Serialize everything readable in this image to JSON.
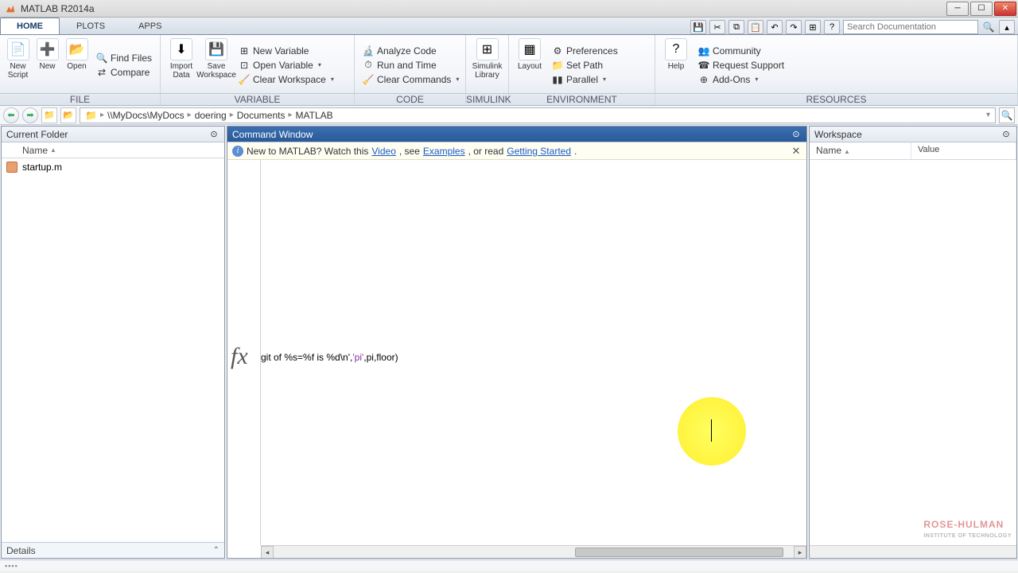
{
  "title": "MATLAB R2014a",
  "tabs": {
    "home": "HOME",
    "plots": "PLOTS",
    "apps": "APPS"
  },
  "search_placeholder": "Search Documentation",
  "ribbon": {
    "new_script": "New\nScript",
    "new": "New",
    "open": "Open",
    "find_files": "Find Files",
    "compare": "Compare",
    "import": "Import\nData",
    "save_ws": "Save\nWorkspace",
    "new_var": "New Variable",
    "open_var": "Open Variable",
    "clear_ws": "Clear Workspace",
    "analyze": "Analyze Code",
    "run_time": "Run and Time",
    "clear_cmd": "Clear Commands",
    "simulink": "Simulink\nLibrary",
    "layout": "Layout",
    "prefs": "Preferences",
    "setpath": "Set Path",
    "parallel": "Parallel",
    "help": "Help",
    "community": "Community",
    "support": "Request Support",
    "addons": "Add-Ons"
  },
  "groups": {
    "file": "FILE",
    "variable": "VARIABLE",
    "code": "CODE",
    "simulink": "SIMULINK",
    "environment": "ENVIRONMENT",
    "resources": "RESOURCES"
  },
  "path": {
    "root": "\\\\MyDocs\\MyDocs",
    "p1": "doering",
    "p2": "Documents",
    "p3": "MATLAB"
  },
  "current_folder": {
    "title": "Current Folder",
    "name_col": "Name",
    "file1": "startup.m",
    "details": "Details"
  },
  "command_window": {
    "title": "Command Window",
    "banner_pre": "New to MATLAB? Watch this ",
    "banner_video": "Video",
    "banner_mid1": ", see ",
    "banner_examples": "Examples",
    "banner_mid2": ", or read ",
    "banner_gs": "Getting Started",
    "cmd_plain1": "git of %s=%f is %d\\n'",
    "cmd_plain2": ",",
    "cmd_str": "'pi'",
    "cmd_plain3": ",pi,floor)"
  },
  "workspace": {
    "title": "Workspace",
    "name_col": "Name",
    "value_col": "Value"
  },
  "logo": {
    "main": "ROSE-HULMAN",
    "sub": "INSTITUTE OF TECHNOLOGY"
  }
}
